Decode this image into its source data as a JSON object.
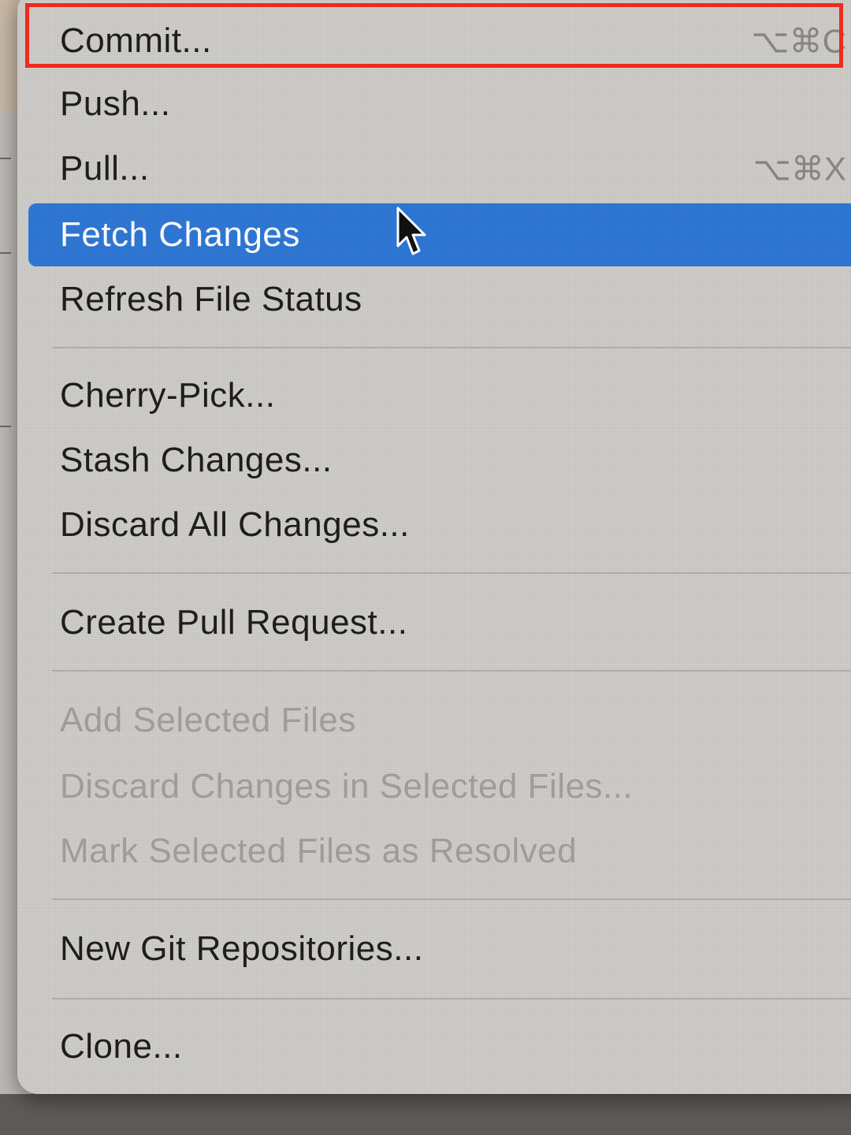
{
  "menu": {
    "items": [
      {
        "label": "Commit...",
        "shortcut": "⌥⌘C",
        "state": "enabled"
      },
      {
        "label": "Push...",
        "state": "enabled"
      },
      {
        "label": "Pull...",
        "shortcut": "⌥⌘X",
        "state": "enabled"
      },
      {
        "label": "Fetch Changes",
        "state": "highlighted"
      },
      {
        "label": "Refresh File Status",
        "state": "enabled"
      },
      {
        "label": "Cherry-Pick...",
        "state": "enabled"
      },
      {
        "label": "Stash Changes...",
        "state": "enabled"
      },
      {
        "label": "Discard All Changes...",
        "state": "enabled"
      },
      {
        "label": "Create Pull Request...",
        "state": "enabled"
      },
      {
        "label": "Add Selected Files",
        "state": "disabled"
      },
      {
        "label": "Discard Changes in Selected Files...",
        "state": "disabled"
      },
      {
        "label": "Mark Selected Files as Resolved",
        "state": "disabled"
      },
      {
        "label": "New Git Repositories...",
        "state": "enabled"
      },
      {
        "label": "Clone...",
        "state": "enabled"
      }
    ]
  },
  "colors": {
    "menu_background": "#cfcdc9",
    "highlight": "#2f78d6",
    "annotation_box": "#f02a1f",
    "disabled_text": "#a3a09c"
  },
  "icons": {
    "cursor": "mouse-pointer-icon"
  }
}
